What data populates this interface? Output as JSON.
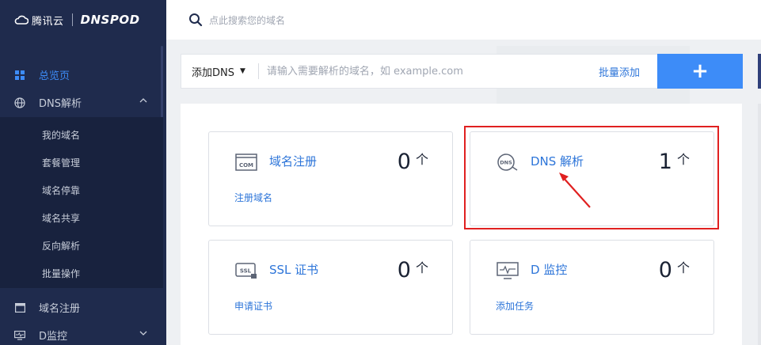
{
  "brand": {
    "name": "腾讯云",
    "product": "DNSPOD"
  },
  "search": {
    "placeholder": "点此搜索您的域名"
  },
  "sidebar": {
    "items": [
      {
        "label": "总览页",
        "icon": "grid-icon",
        "active": true
      },
      {
        "label": "DNS解析",
        "icon": "globe-icon",
        "expanded": true
      },
      {
        "label": "域名注册",
        "icon": "window-icon"
      },
      {
        "label": "D监控",
        "icon": "monitor-icon",
        "expandable": true
      }
    ],
    "sub_items": [
      "我的域名",
      "套餐管理",
      "域名停靠",
      "域名共享",
      "反向解析",
      "批量操作"
    ]
  },
  "add_dns": {
    "select_label": "添加DNS",
    "input_placeholder": "请输入需要解析的域名，如 example.com",
    "batch_label": "批量添加",
    "add_button": "+"
  },
  "cards": [
    {
      "title": "域名注册",
      "count": "0",
      "unit": "个",
      "link": "注册域名",
      "icon": "com-icon"
    },
    {
      "title": "DNS 解析",
      "count": "1",
      "unit": "个",
      "link": "",
      "icon": "dns-icon"
    },
    {
      "title": "SSL 证书",
      "count": "0",
      "unit": "个",
      "link": "申请证书",
      "icon": "ssl-icon"
    },
    {
      "title": "D 监控",
      "count": "0",
      "unit": "个",
      "link": "添加任务",
      "icon": "monitor-icon"
    }
  ],
  "colors": {
    "accent": "#3d8cf8",
    "sidebar_bg": "#1f2b4d",
    "link": "#2d75d9",
    "highlight": "#e02020"
  }
}
